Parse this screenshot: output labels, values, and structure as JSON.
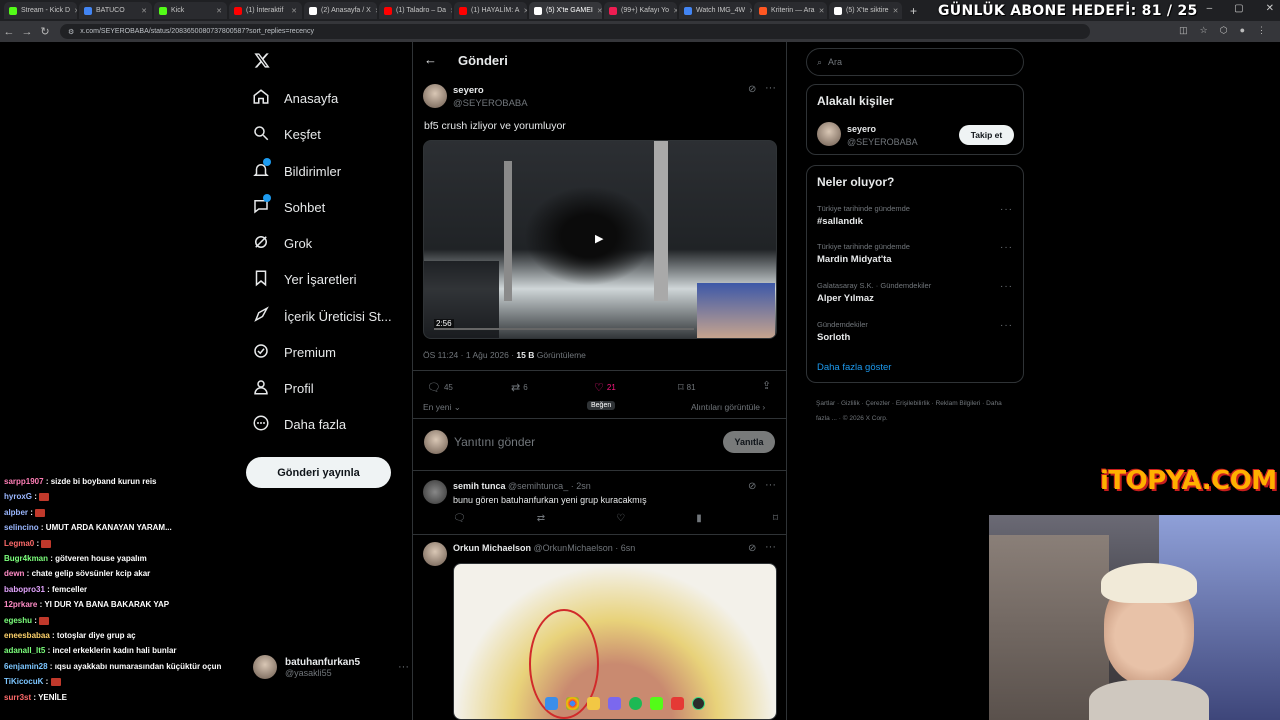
{
  "browser": {
    "tabs": [
      {
        "title": "Stream - Kick D",
        "color": "#53fc18"
      },
      {
        "title": "BATUCO",
        "color": "#4285f4"
      },
      {
        "title": "Kick",
        "color": "#53fc18"
      },
      {
        "title": "(1) İnteraktif",
        "color": "#ff0000"
      },
      {
        "title": "(2) Anasayfa / X",
        "color": "#ffffff"
      },
      {
        "title": "(1) Taladro – Da",
        "color": "#ff0000"
      },
      {
        "title": "(1) HAYALİM: A",
        "color": "#ff0000"
      },
      {
        "title": "(5) X'te GAMEI",
        "color": "#ffffff"
      },
      {
        "title": "(99+) Kafayı Yo",
        "color": "#ee1d52"
      },
      {
        "title": "Watch IMG_4W",
        "color": "#4285f4"
      },
      {
        "title": "Kriterin — Ara",
        "color": "#ff5722"
      },
      {
        "title": "(5) X'te siktire",
        "color": "#ffffff"
      }
    ],
    "url": "x.com/SEYEROBABA/status/2083650080737800587?sort_replies=recency",
    "overlay_goal": "GÜNLÜK ABONE HEDEFİ: 81 / 25"
  },
  "nav": {
    "items": [
      {
        "label": "Anasayfa",
        "icon": "home-icon"
      },
      {
        "label": "Keşfet",
        "icon": "search-icon"
      },
      {
        "label": "Bildirimler",
        "icon": "bell-icon"
      },
      {
        "label": "Sohbet",
        "icon": "chat-icon"
      },
      {
        "label": "Grok",
        "icon": "grok-icon"
      },
      {
        "label": "Yer İşaretleri",
        "icon": "bookmark-icon"
      },
      {
        "label": "İçerik Üreticisi St...",
        "icon": "rocket-icon"
      },
      {
        "label": "Premium",
        "icon": "premium-icon"
      },
      {
        "label": "Profil",
        "icon": "person-icon"
      },
      {
        "label": "Daha fazla",
        "icon": "more-icon"
      }
    ],
    "post_button": "Gönderi yayınla",
    "account": {
      "name": "batuhanfurkan5",
      "handle": "@yasakli55"
    }
  },
  "main": {
    "header_title": "Gönderi",
    "post": {
      "author": "seyero",
      "handle": "@SEYEROBABA",
      "text": "bf5 crush izliyor ve yorumluyor",
      "video_duration": "2:56",
      "time": "ÖS 11:24 · 1 Ağu 2026 · ",
      "views_count": "15 B",
      "views_label": " Görüntüleme",
      "replies": "45",
      "reposts": "6",
      "likes": "21",
      "bookmarks": "81",
      "like_tooltip": "Beğen",
      "sort_label": "En yeni",
      "quotes_link": "Alıntıları görüntüle"
    },
    "reply_box": {
      "placeholder": "Yanıtını gönder",
      "button": "Yanıtla"
    },
    "replies": [
      {
        "name": "semih tunca",
        "handle": "@semihtunca_",
        "time": "· 2sn",
        "text": "bunu gören batuhanfurkan yeni grup kuracakmış"
      },
      {
        "name": "Orkun Michaelson",
        "handle": "@OrkunMichaelson",
        "time": "· 6sn",
        "text": ""
      }
    ]
  },
  "sidebar": {
    "search_placeholder": "Ara",
    "relevant_title": "Alakalı kişiler",
    "relevant_person": {
      "name": "seyero",
      "handle": "@SEYEROBABA",
      "follow": "Takip et"
    },
    "trends_title": "Neler oluyor?",
    "trends": [
      {
        "context": "Türkiye tarihinde gündemde",
        "name": "#sallandık"
      },
      {
        "context": "Türkiye tarihinde gündemde",
        "name": "Mardin Midyat'ta"
      },
      {
        "context": "Galatasaray S.K. · Gündemdekiler",
        "name": "Alper Yılmaz"
      },
      {
        "context": "Gündemdekiler",
        "name": "Sorloth"
      }
    ],
    "show_more": "Daha fazla göster",
    "footer": [
      "Şartlar",
      "Gizlilik",
      "Çerezler",
      "Erişilebilirlik",
      "Reklam Bilgileri",
      "Daha fazla ...",
      "© 2026 X Corp."
    ]
  },
  "chat": [
    {
      "user": "sarpp1907",
      "color": "#ff7eb6",
      "msg": "sizde bi boyband kurun reis"
    },
    {
      "user": "hyroxG",
      "color": "#9ab7ff",
      "msg": "",
      "emote": true
    },
    {
      "user": "alpber",
      "color": "#9ab7ff",
      "msg": "",
      "emote": true
    },
    {
      "user": "selincino",
      "color": "#9ab7ff",
      "msg": "UMUT ARDA KANAYAN YARAM..."
    },
    {
      "user": "Legma0",
      "color": "#ff6b6b",
      "msg": "",
      "emote": true
    },
    {
      "user": "Bugr4kman",
      "color": "#7cff7c",
      "msg": "götveren house yapalım"
    },
    {
      "user": "dewn",
      "color": "#ff8cc6",
      "msg": "chate gelip sövsünler kcip akar"
    },
    {
      "user": "babopro31",
      "color": "#e4a5ff",
      "msg": "femceller"
    },
    {
      "user": "12prkare",
      "color": "#ff8cc6",
      "msg": "YI DUR YA BANA BAKARAK YAP"
    },
    {
      "user": "egeshu",
      "color": "#7cff7c",
      "msg": "",
      "emote": true
    },
    {
      "user": "eneesbabaa",
      "color": "#ffd36b",
      "msg": "totoşlar diye grup aç"
    },
    {
      "user": "adanall_lt5",
      "color": "#7cff7c",
      "msg": "incel erkeklerin kadın hali bunlar"
    },
    {
      "user": "6enjamin28",
      "color": "#7cc6ff",
      "msg": "ıqsu ayakkabı numarasından küçüktür oçun"
    },
    {
      "user": "TiKicocuK",
      "color": "#7cc6ff",
      "msg": "",
      "emote": true
    },
    {
      "user": "surr3st",
      "color": "#ff6b6b",
      "msg": "YENİLE"
    }
  ],
  "watermark": "iTOPYA.COM"
}
